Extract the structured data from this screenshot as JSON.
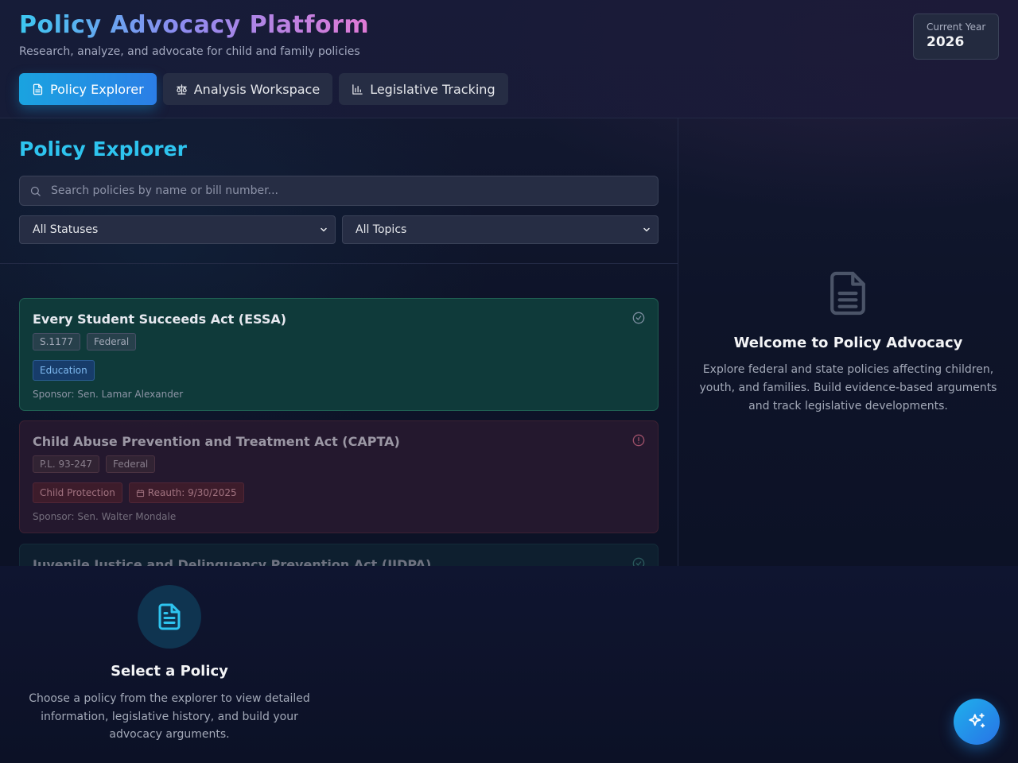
{
  "header": {
    "title": "Policy Advocacy Platform",
    "subtitle": "Research, analyze, and advocate for child and family policies",
    "year_label": "Current Year",
    "year_value": "2026"
  },
  "tabs": [
    {
      "label": "Policy Explorer",
      "icon": "document-icon",
      "active": true
    },
    {
      "label": "Analysis Workspace",
      "icon": "scale-icon",
      "active": false
    },
    {
      "label": "Legislative Tracking",
      "icon": "bar-chart-icon",
      "active": false
    }
  ],
  "explorer": {
    "title": "Policy Explorer",
    "search_placeholder": "Search policies by name or bill number...",
    "status_filter": "All Statuses",
    "topic_filter": "All Topics"
  },
  "policies": [
    {
      "title": "Every Student Succeeds Act (ESSA)",
      "bill": "S.1177",
      "level": "Federal",
      "topic": "Education",
      "sponsor": "Sponsor: Sen. Lamar Alexander",
      "status_icon": "check-circle-icon"
    },
    {
      "title": "Child Abuse Prevention and Treatment Act (CAPTA)",
      "bill": "P.L. 93-247",
      "level": "Federal",
      "topic": "Child Protection",
      "reauth": "Reauth: 9/30/2025",
      "sponsor": "Sponsor: Sen. Walter Mondale",
      "status_icon": "alert-circle-icon"
    },
    {
      "title": "Juvenile Justice and Delinquency Prevention Act (JJDPA)",
      "status_icon": "check-circle-icon"
    }
  ],
  "welcome": {
    "title": "Welcome to Policy Advocacy",
    "text": "Explore federal and state policies affecting children, youth, and families. Build evidence-based arguments and track legislative developments."
  },
  "select_policy": {
    "title": "Select a Policy",
    "text": "Choose a policy from the explorer to view detailed information, legislative history, and build your advocacy arguments."
  },
  "colors": {
    "accent": "#2ec4ef",
    "primary_button": "#1aa3e0",
    "background": "#0d1226"
  }
}
